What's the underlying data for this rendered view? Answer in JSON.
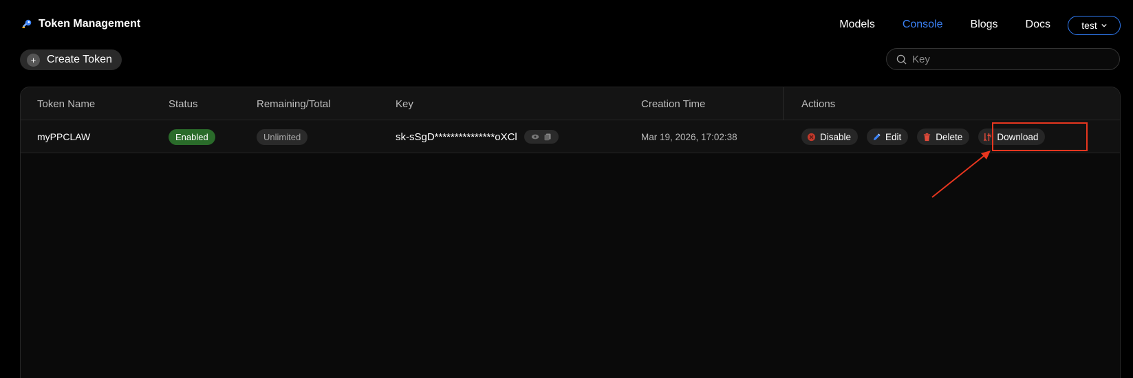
{
  "header": {
    "title": "Token Management",
    "nav": [
      "Models",
      "Console",
      "Blogs",
      "Docs"
    ],
    "active_nav": "Console",
    "user": "test"
  },
  "toolbar": {
    "create_label": "Create Token",
    "search_placeholder": "Key"
  },
  "table": {
    "columns": [
      "Token Name",
      "Status",
      "Remaining/Total",
      "Key",
      "Creation Time",
      "Actions"
    ],
    "rows": [
      {
        "name": "myPPCLAW",
        "status": "Enabled",
        "remaining": "Unlimited",
        "key": "sk-sSgD***************oXCl",
        "created": "Mar 19, 2026, 17:02:38",
        "actions": [
          "Disable",
          "Edit",
          "Delete",
          "Download"
        ]
      }
    ]
  },
  "colors": {
    "accent": "#3b82f6",
    "enabled_badge": "#2a6b2a",
    "annotation": "#e8361f"
  },
  "icons": {
    "brand": "key-icon",
    "search": "search-icon",
    "create": "plus-icon",
    "show_key": "eye-icon",
    "copy_key": "copy-icon",
    "disable": "stop-icon",
    "edit": "pencil-icon",
    "delete": "trash-icon",
    "download": "download-icon",
    "user_menu": "chevron-down-icon"
  }
}
